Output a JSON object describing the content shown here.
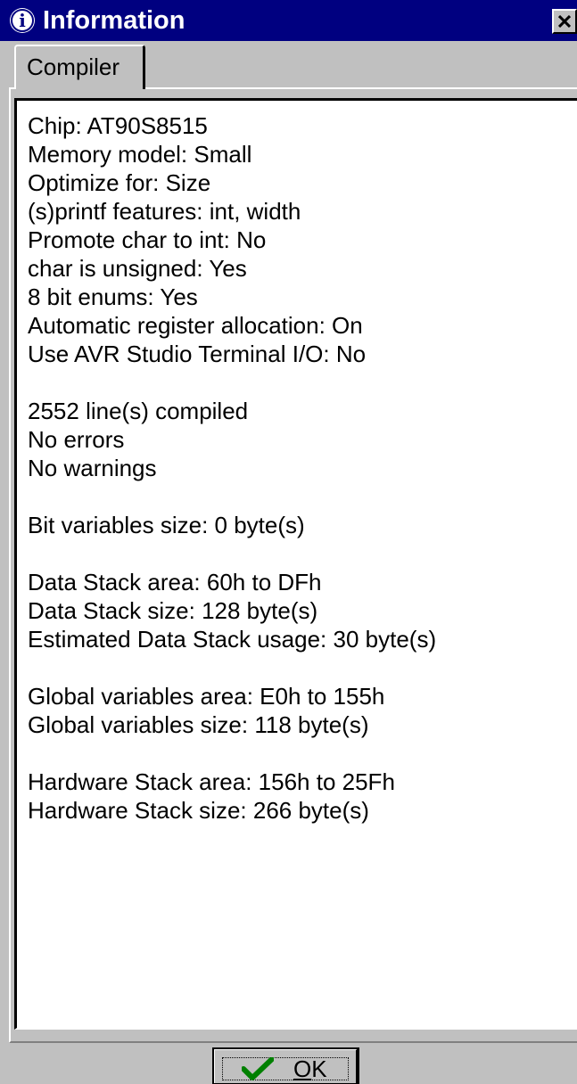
{
  "window": {
    "title": "Information"
  },
  "icons": {
    "title_icon": "info-icon",
    "close_icon": "close-icon",
    "ok_icon": "checkmark-icon"
  },
  "tabs": [
    {
      "label": "Compiler",
      "selected": true
    }
  ],
  "info_lines": [
    "Chip: AT90S8515",
    "Memory model: Small",
    "Optimize for: Size",
    "(s)printf features: int, width",
    "Promote char to int: No",
    "char is unsigned: Yes",
    "8 bit enums: Yes",
    "Automatic register allocation: On",
    "Use AVR Studio Terminal I/O: No",
    "",
    "2552 line(s) compiled",
    "No errors",
    "No warnings",
    "",
    "Bit variables size: 0 byte(s)",
    "",
    "Data Stack area: 60h to DFh",
    "Data Stack size: 128 byte(s)",
    "Estimated Data Stack usage: 30 byte(s)",
    "",
    "Global variables area: E0h to 155h",
    "Global variables size: 118 byte(s)",
    "",
    "Hardware Stack area: 156h to 25Fh",
    "Hardware Stack size: 266 byte(s)"
  ],
  "buttons": {
    "ok_label": "OK",
    "ok_mnemonic": "O"
  },
  "colors": {
    "titlebar": "#000080",
    "face": "#c0c0c0",
    "memo_background": "#ffffff",
    "check_green": "#008000"
  }
}
